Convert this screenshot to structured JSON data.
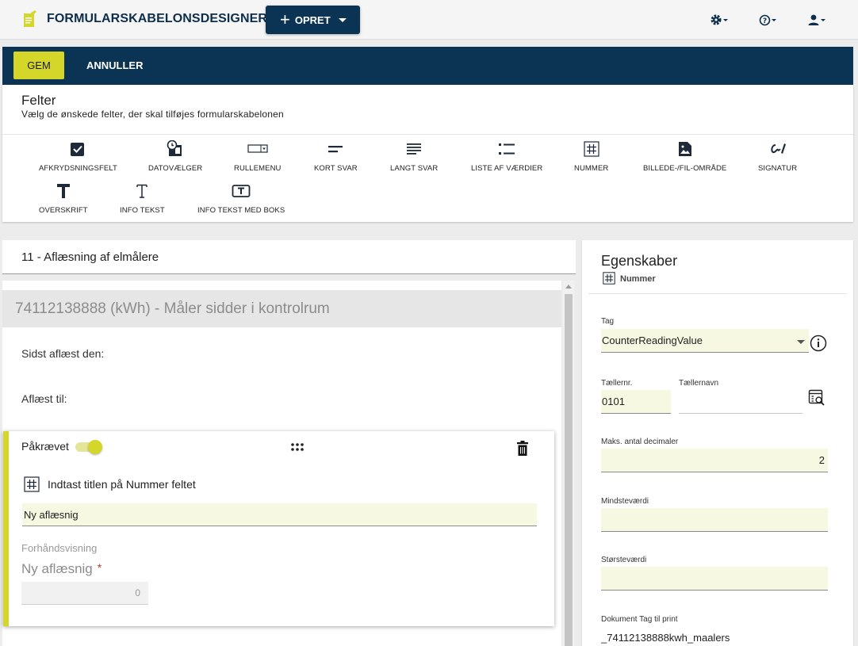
{
  "app": {
    "title": "FORMULARSKABELONSDESIGNER",
    "create_label": "OPRET",
    "icons": [
      "settings-icon",
      "help-icon",
      "user-icon"
    ]
  },
  "actions": {
    "save_label": "GEM",
    "cancel_label": "ANNULLER"
  },
  "fields_panel": {
    "title": "Felter",
    "subtitle": "Vælg de ønskede felter, der skal tilføjes formularskabelonen",
    "tools": [
      {
        "label": "AFKRYDSNINGSFELT",
        "icon": "checkbox-icon"
      },
      {
        "label": "DATOVÆLGER",
        "icon": "date-picker-icon"
      },
      {
        "label": "RULLEMENU",
        "icon": "dropdown-icon"
      },
      {
        "label": "KORT SVAR",
        "icon": "short-answer-icon"
      },
      {
        "label": "LANGT SVAR",
        "icon": "long-answer-icon"
      },
      {
        "label": "LISTE AF VÆRDIER",
        "icon": "value-list-icon"
      },
      {
        "label": "NUMMER",
        "icon": "number-icon"
      },
      {
        "label": "BILLEDE-/FIL-OMRÅDE",
        "icon": "image-file-icon"
      },
      {
        "label": "SIGNATUR",
        "icon": "signature-icon"
      },
      {
        "label": "OVERSKRIFT",
        "icon": "heading-icon"
      },
      {
        "label": "INFO TEKST",
        "icon": "info-text-icon"
      },
      {
        "label": "INFO TEKST MED BOKS",
        "icon": "info-text-box-icon"
      }
    ]
  },
  "form": {
    "header": "11 - Aflæsning af elmålere",
    "section_title": "74112138888 (kWh) - Måler sidder i kontrolrum",
    "static_fields": [
      "Sidst aflæst den:",
      "Aflæst til:"
    ],
    "selected_field": {
      "required_label": "Påkrævet",
      "required": true,
      "title_prompt": "Indtast titlen på Nummer feltet",
      "title_value": "Ny aflæsnig",
      "preview_label": "Forhåndsvisning",
      "preview_name": "Ny aflæsnig",
      "required_mark": "*",
      "preview_value": "0"
    }
  },
  "properties": {
    "title": "Egenskaber",
    "type_label": "Nummer",
    "tag_label": "Tag",
    "tag_value": "CounterReadingValue",
    "counter_no_label": "Tællernr.",
    "counter_no_value": "0101",
    "counter_name_label": "Tællernavn",
    "counter_name_value": "",
    "max_decimals_label": "Maks. antal decimaler",
    "max_decimals_value": "2",
    "min_label": "Mindsteværdi",
    "min_value": "",
    "max_label": "Størsteværdi",
    "max_value": "",
    "doc_tag_label": "Dokument Tag til print",
    "doc_tag_value": "_74112138888kwh_maalers"
  },
  "colors": {
    "navy": "#0b3354",
    "accent": "#d5d62a",
    "input_bg": "#f6f8e2"
  }
}
